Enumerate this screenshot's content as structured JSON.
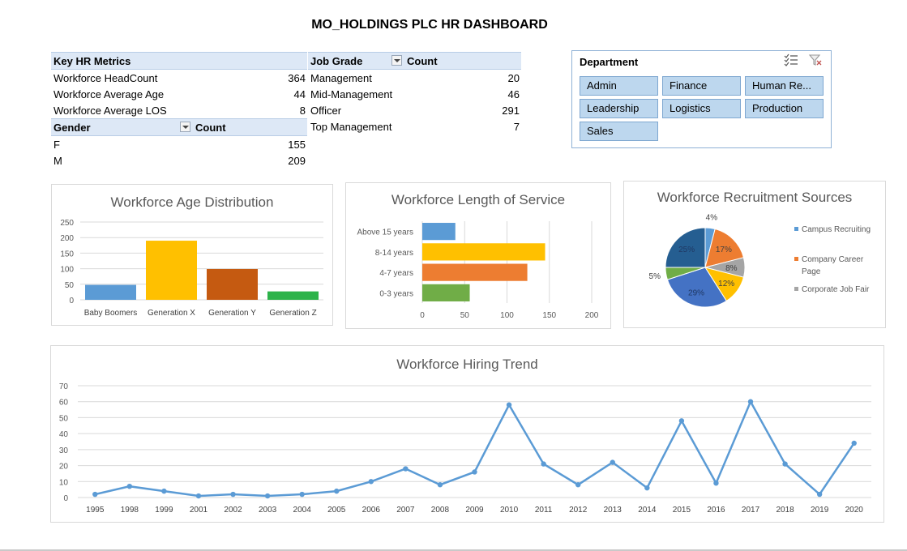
{
  "title": "MO_HOLDINGS PLC HR DASHBOARD",
  "key_metrics": {
    "header": "Key HR Metrics",
    "rows": [
      {
        "label": "Workforce HeadCount",
        "value": "364"
      },
      {
        "label": "Workforce Average Age",
        "value": "44"
      },
      {
        "label": "Workforce Average LOS",
        "value": "8"
      }
    ]
  },
  "gender": {
    "header": "Gender",
    "count_header": "Count",
    "rows": [
      {
        "label": "F",
        "value": "155"
      },
      {
        "label": "M",
        "value": "209"
      }
    ]
  },
  "job_grade": {
    "header": "Job Grade",
    "count_header": "Count",
    "rows": [
      {
        "label": "Management",
        "value": "20"
      },
      {
        "label": "Mid-Management",
        "value": "46"
      },
      {
        "label": "Officer",
        "value": "291"
      },
      {
        "label": "Top Management",
        "value": "7"
      }
    ]
  },
  "department_slicer": {
    "header": "Department",
    "icons": [
      "multi-select-icon",
      "clear-filter-icon"
    ],
    "buttons": [
      "Admin",
      "Finance",
      "Human Re...",
      "Leadership",
      "Logistics",
      "Production",
      "Sales"
    ]
  },
  "chart_data": [
    {
      "type": "bar",
      "title": "Workforce Age Distribution",
      "categories": [
        "Baby Boomers",
        "Generation X",
        "Generation Y",
        "Generation Z"
      ],
      "values": [
        48,
        190,
        99,
        27
      ],
      "colors": [
        "#5b9bd5",
        "#ffc000",
        "#c55a11",
        "#2db34a"
      ],
      "ylim": [
        0,
        250
      ],
      "yticks": [
        "0",
        "50",
        "100",
        "150",
        "200",
        "250"
      ],
      "grid": true
    },
    {
      "type": "bar",
      "orientation": "horizontal",
      "title": "Workforce Length of Service",
      "categories": [
        "Above 15 years",
        "8-14 years",
        "4-7 years",
        "0-3 years"
      ],
      "values": [
        39,
        145,
        124,
        56
      ],
      "colors": [
        "#5b9bd5",
        "#ffc000",
        "#ed7d31",
        "#70ad47"
      ],
      "xlim": [
        0,
        200
      ],
      "xticks": [
        "0",
        "50",
        "100",
        "150",
        "200"
      ],
      "grid": true
    },
    {
      "type": "pie",
      "title": "Workforce Recruitment Sources",
      "slices": [
        {
          "label": "4%",
          "value": 4,
          "color": "#5b9bd5"
        },
        {
          "label": "17%",
          "value": 17,
          "color": "#ed7d31"
        },
        {
          "label": "8%",
          "value": 8,
          "color": "#a5a5a5"
        },
        {
          "label": "12%",
          "value": 12,
          "color": "#ffc000"
        },
        {
          "label": "29%",
          "value": 29,
          "color": "#4472c4"
        },
        {
          "label": "5%",
          "value": 5,
          "color": "#70ad47"
        },
        {
          "label": "25%",
          "value": 25,
          "color": "#255e91"
        }
      ],
      "legend": [
        {
          "label": "Campus Recruiting",
          "color": "#5b9bd5"
        },
        {
          "label": "Company Career Page",
          "color": "#ed7d31"
        },
        {
          "label": "Corporate Job Fair",
          "color": "#a5a5a5"
        }
      ],
      "legend_position": "right"
    },
    {
      "type": "line",
      "title": "Workforce Hiring Trend",
      "x": [
        "1995",
        "1998",
        "1999",
        "2001",
        "2002",
        "2003",
        "2004",
        "2005",
        "2006",
        "2007",
        "2008",
        "2009",
        "2010",
        "2011",
        "2012",
        "2013",
        "2014",
        "2015",
        "2016",
        "2017",
        "2018",
        "2019",
        "2020"
      ],
      "values": [
        2,
        7,
        4,
        1,
        2,
        1,
        2,
        4,
        10,
        18,
        8,
        16,
        58,
        21,
        8,
        22,
        6,
        48,
        9,
        60,
        21,
        2,
        34
      ],
      "color": "#5b9bd5",
      "ylim": [
        0,
        70
      ],
      "yticks": [
        "0",
        "10",
        "20",
        "30",
        "40",
        "50",
        "60",
        "70"
      ],
      "grid": true
    }
  ]
}
